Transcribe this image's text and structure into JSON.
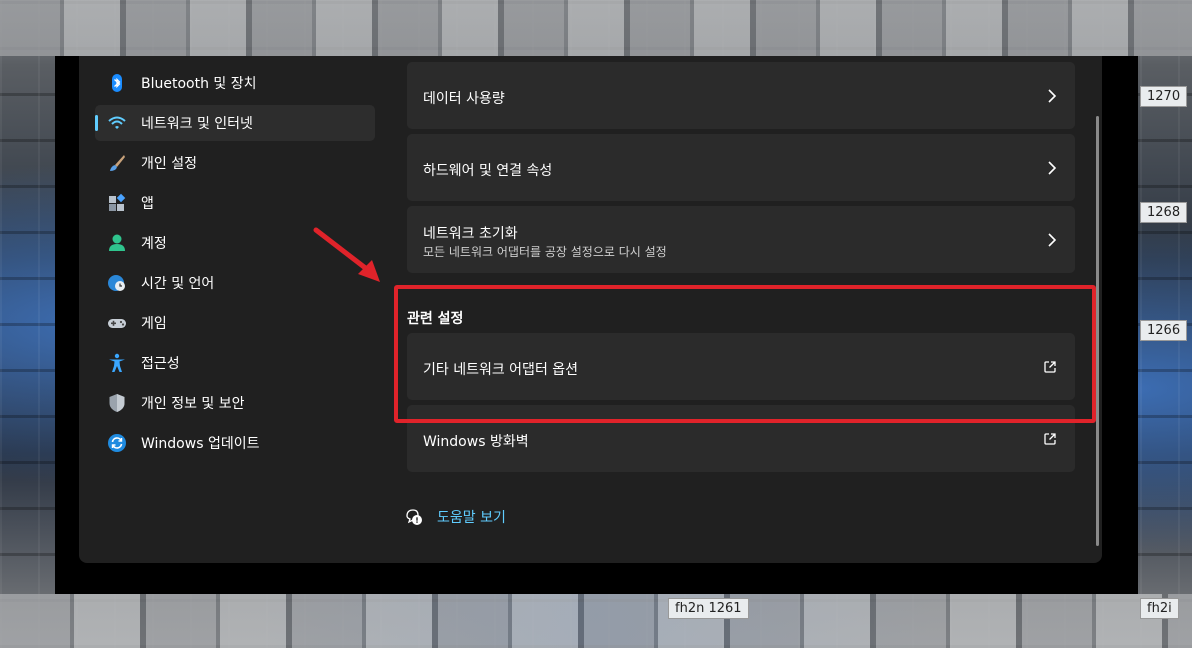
{
  "background": {
    "rack_labels": [
      "1270",
      "1268",
      "1266",
      "fh2n 1261",
      "fh2i"
    ]
  },
  "sidebar": {
    "items": [
      {
        "label": "Bluetooth 및 장치",
        "icon": "bluetooth-icon",
        "active": false
      },
      {
        "label": "네트워크 및 인터넷",
        "icon": "wifi-icon",
        "active": true
      },
      {
        "label": "개인 설정",
        "icon": "paintbrush-icon",
        "active": false
      },
      {
        "label": "앱",
        "icon": "apps-icon",
        "active": false
      },
      {
        "label": "계정",
        "icon": "account-icon",
        "active": false
      },
      {
        "label": "시간 및 언어",
        "icon": "globe-clock-icon",
        "active": false
      },
      {
        "label": "게임",
        "icon": "gamepad-icon",
        "active": false
      },
      {
        "label": "접근성",
        "icon": "accessibility-icon",
        "active": false
      },
      {
        "label": "개인 정보 및 보안",
        "icon": "shield-icon",
        "active": false
      },
      {
        "label": "Windows 업데이트",
        "icon": "update-icon",
        "active": false
      }
    ]
  },
  "main": {
    "cards": [
      {
        "label": "데이터 사용량",
        "subtitle": "",
        "action": "chevron-right-icon"
      },
      {
        "label": "하드웨어 및 연결 속성",
        "subtitle": "",
        "action": "chevron-right-icon"
      },
      {
        "label": "네트워크 초기화",
        "subtitle": "모든 네트워크 어댑터를 공장 설정으로 다시 설정",
        "action": "chevron-right-icon"
      }
    ],
    "related_section_title": "관련 설정",
    "related": [
      {
        "label": "기타 네트워크 어댑터 옵션",
        "action": "external-link-icon"
      },
      {
        "label": "Windows 방화벽",
        "action": "external-link-icon"
      }
    ],
    "help_label": "도움말 보기"
  },
  "colors": {
    "accent": "#60cdff",
    "window_bg": "#202020",
    "card_bg": "#2b2b2b",
    "highlight": "#e0232a"
  }
}
